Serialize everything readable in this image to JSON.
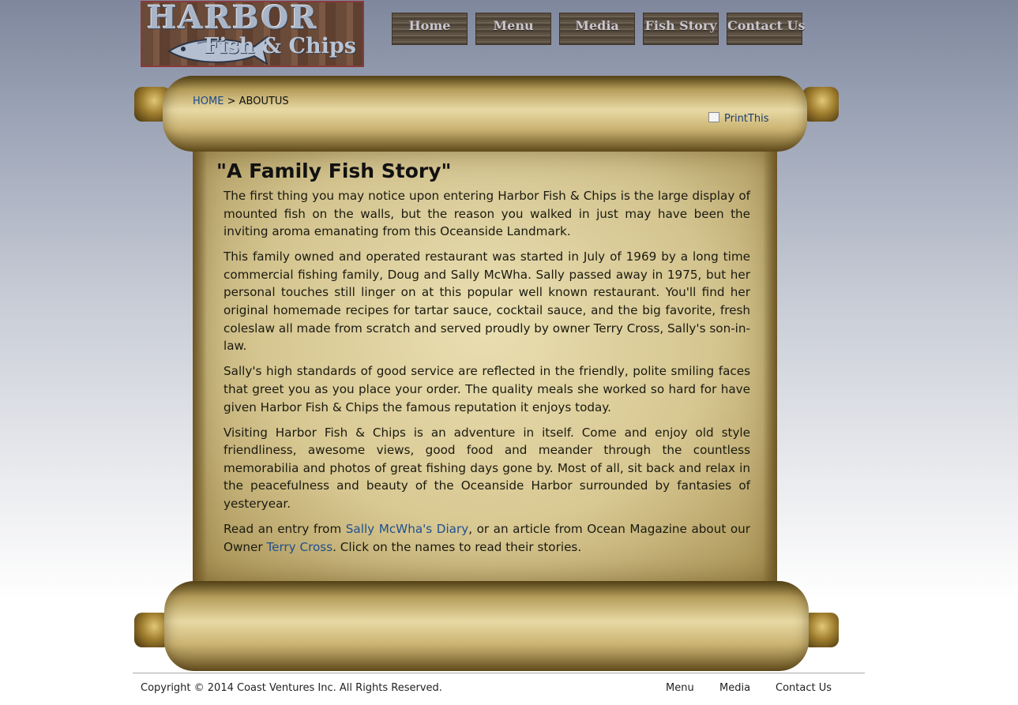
{
  "header": {
    "logo": {
      "line1": "HARBOR",
      "line2": "Fish & Chips"
    },
    "nav": [
      {
        "label": "Home"
      },
      {
        "label": "Menu"
      },
      {
        "label": "Media"
      },
      {
        "label": "Fish Story"
      },
      {
        "label": "Contact Us"
      }
    ]
  },
  "breadcrumb": {
    "home": "HOME",
    "separator": " > ",
    "current": "ABOUTUS"
  },
  "print_link": "PrintThis",
  "article": {
    "title": "\"A Family Fish Story\"",
    "paragraphs": [
      "The first thing you may notice upon entering Harbor Fish & Chips is the large display of mounted fish on the walls, but the reason you walked in just may have been the inviting aroma emanating from this Oceanside Landmark.",
      "This family owned and operated restaurant was started in July of 1969 by a long time commercial fishing family, Doug and Sally McWha. Sally passed away in 1975, but her personal touches still linger on at this popular well known restaurant. You'll find her original homemade recipes for tartar sauce, cocktail sauce, and the big favorite, fresh coleslaw all made from scratch and served proudly by owner Terry Cross, Sally's son-in-law.",
      "Sally's high standards of good service are reflected in the friendly, polite smiling faces that greet you as you place your order. The quality meals she worked so hard for have given Harbor Fish & Chips the famous reputation it enjoys today.",
      "Visiting Harbor Fish & Chips is an adventure in itself. Come and enjoy old style friendliness, awesome views, good food and meander through the countless memorabilia and photos of great fishing days gone by. Most of all, sit back and relax in the peacefulness and beauty of the Oceanside Harbor surrounded by fantasies of yesteryear."
    ],
    "last": {
      "pre": "Read an entry from ",
      "link1": "Sally McWha's Diary",
      "mid": ", or an article from Ocean Magazine about our Owner ",
      "link2": "Terry Cross",
      "post": ". Click on the names to read their stories."
    }
  },
  "footer": {
    "copyright": "Copyright © 2014 Coast Ventures Inc. All Rights Reserved.",
    "links": [
      {
        "label": "Menu"
      },
      {
        "label": "Media"
      },
      {
        "label": "Contact Us"
      }
    ]
  },
  "colors": {
    "link": "#1f4f8f",
    "parchment": "#d6c488",
    "nav_button": "#5b5042"
  },
  "icons": {
    "print": "printer-icon",
    "logo_fish": "fish-icon"
  }
}
